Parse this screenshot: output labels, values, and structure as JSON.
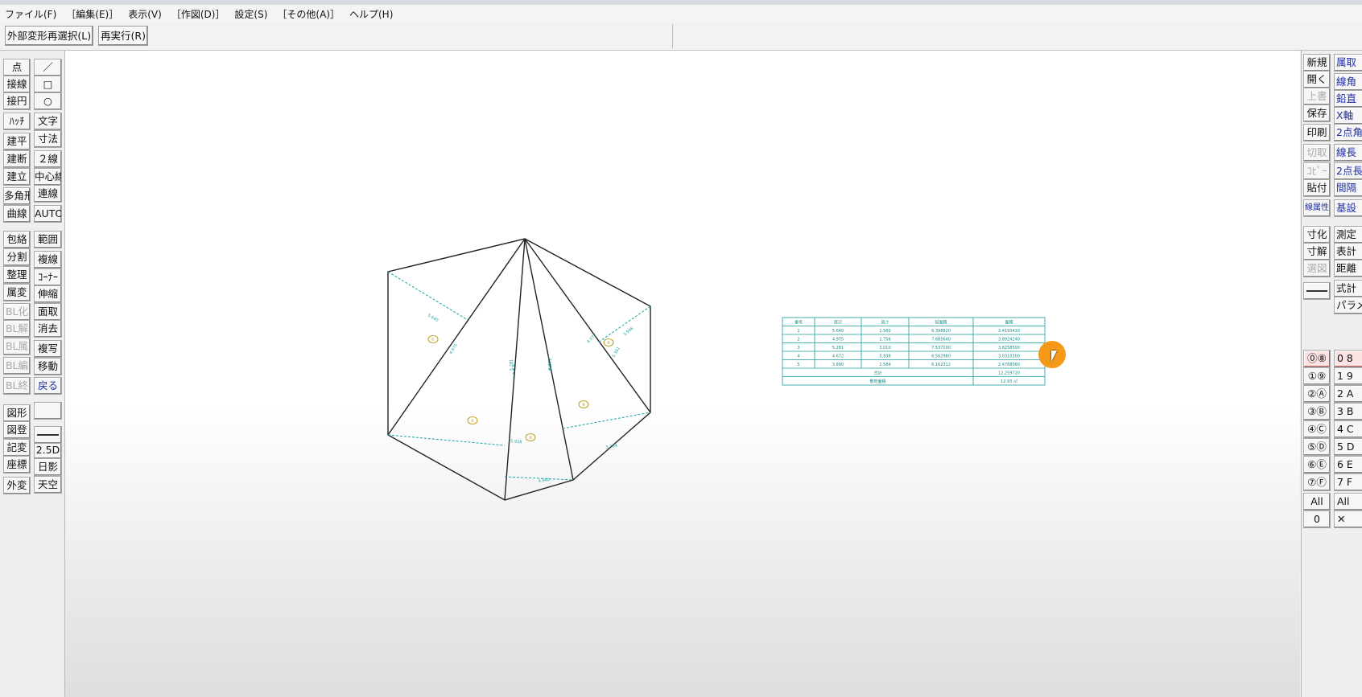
{
  "menu": [
    "ファイル(F)",
    "［編集(E)］",
    "表示(V)",
    "［作図(D)］",
    "設定(S)",
    "［その他(A)］",
    "ヘルプ(H)"
  ],
  "toolbar": {
    "reselect_label": "外部変形再選択(L)",
    "rerun_label": "再実行(R)"
  },
  "left_tools": {
    "col1": [
      "点",
      "接線",
      "接円",
      "ﾊｯﾁ",
      "建平",
      "建断",
      "建立",
      "多角形",
      "曲線",
      "包絡",
      "分割",
      "整理",
      "属変",
      "BL化",
      "BL解",
      "BL属",
      "BL編",
      "BL終",
      "図形",
      "図登",
      "記変",
      "座標",
      "外変"
    ],
    "col2": [
      "／",
      "□",
      "○",
      "文字",
      "寸法",
      "２線",
      "中心線",
      "連線",
      "AUTO",
      "範囲",
      "複線",
      "ｺｰﾅｰ",
      "伸縮",
      "面取",
      "消去",
      "複写",
      "移動",
      "戻る",
      "",
      "2.5D",
      "日影",
      "天空"
    ]
  },
  "right_tools": {
    "col1": [
      "新規",
      "開く",
      "上書",
      "保存",
      "印刷",
      "切取",
      "ｺﾋﾟｰ",
      "貼付",
      "線属性",
      "寸化",
      "寸解",
      "選図"
    ],
    "col2": [
      "属取",
      "線角",
      "鉛直",
      "X軸",
      "2点角",
      "線長",
      "2点長",
      "間隔",
      "基設",
      "測定",
      "表計",
      "距離",
      "式計",
      "パラメ"
    ],
    "layers_a": [
      "⓪⑧",
      "①⑨",
      "②Ⓐ",
      "③Ⓑ",
      "④Ⓒ",
      "⑤Ⓓ",
      "⑥Ⓔ",
      "⑦Ⓕ",
      "All",
      "0"
    ],
    "layers_b": [
      "0 8",
      "1 9",
      "2 A",
      "3 B",
      "4 C",
      "5 D",
      "6 E",
      "7 F",
      "All",
      "✕"
    ]
  },
  "drawing": {
    "triangle_labels": [
      "①",
      "②",
      "③",
      "④",
      "⑤"
    ],
    "dimension_labels": [
      "5.640",
      "4.975",
      "5.281",
      "6.672",
      "5.938",
      "4.940",
      "5.184",
      "4.077",
      "5.381",
      "3.946"
    ]
  },
  "area_table": {
    "headers": [
      "番号",
      "底辺",
      "高さ",
      "倍面積",
      "面積"
    ],
    "rows": [
      [
        "1",
        "5.640",
        "1.560",
        "6.398820",
        "3.4193410"
      ],
      [
        "2",
        "4.975",
        "1.756",
        "7.685640",
        "3.8924240"
      ],
      [
        "3",
        "5.281",
        "3.010",
        "7.537100",
        "3.8258500"
      ],
      [
        "4",
        "4.672",
        "5.938",
        "6.562980",
        "3.0310300"
      ],
      [
        "5",
        "3.890",
        "1.584",
        "6.162312",
        "2.4768060"
      ]
    ],
    "total_label": "合計",
    "total_value": "12.259720",
    "site_area_label": "敷地面積",
    "site_area_value": "12.93 ㎡"
  },
  "colors": {
    "dimension": "#1aa3a3",
    "triangle_label": "#b8a020",
    "table": "#1a9a9a",
    "cursor": "#f59a16"
  }
}
